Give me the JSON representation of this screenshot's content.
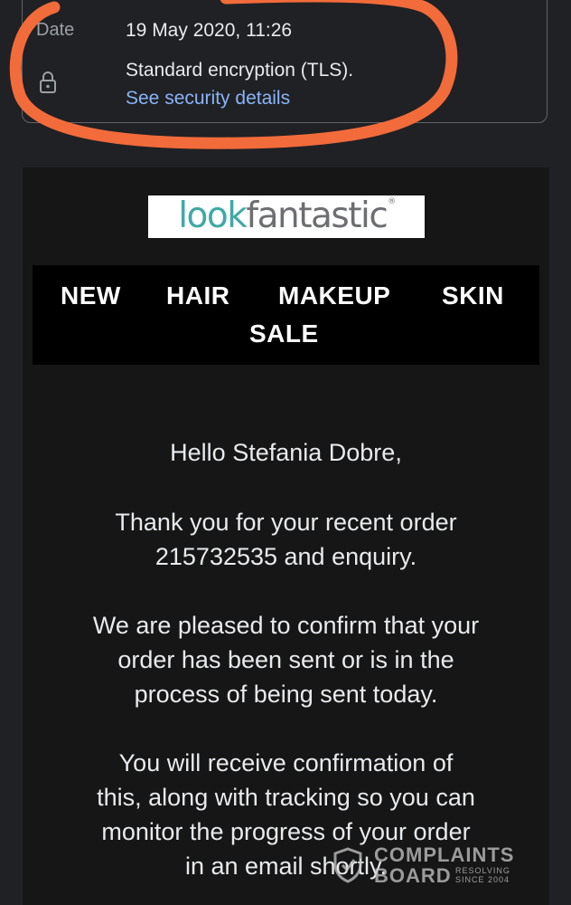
{
  "details": {
    "date_label": "Date",
    "date_value": "19 May 2020, 11:26",
    "encryption": "Standard encryption (TLS).",
    "security_link": "See security details"
  },
  "email": {
    "logo": {
      "look": "look",
      "fantastic": "fantastic",
      "reg": "®"
    },
    "nav": {
      "new": "NEW",
      "hair": "HAIR",
      "makeup": "MAKEUP",
      "skin": "SKIN",
      "sale": "SALE"
    },
    "greeting": "Hello Stefania Dobre,",
    "thanks_line1": "Thank you for your recent order",
    "thanks_line2": "215732535 and enquiry.",
    "confirm_line1": "We are pleased to confirm that your",
    "confirm_line2": "order has been sent or is in the",
    "confirm_line3": "process of being sent today.",
    "receive_line1": "You will receive confirmation of",
    "receive_line2": "this, along with tracking so you can",
    "receive_line3": "monitor the progress of your order",
    "receive_line4": "in an email shortly."
  },
  "watermark": {
    "title": "COMPLAINTS",
    "board": "BOARD",
    "sub1": "RESOLVING",
    "sub2": "SINCE 2004"
  },
  "colors": {
    "background": "#202124",
    "email_background": "#161616",
    "link": "#8ab4f8",
    "highlight": "#f26b3a",
    "logo_teal": "#3fa9a6",
    "logo_grey": "#6d6e71"
  }
}
